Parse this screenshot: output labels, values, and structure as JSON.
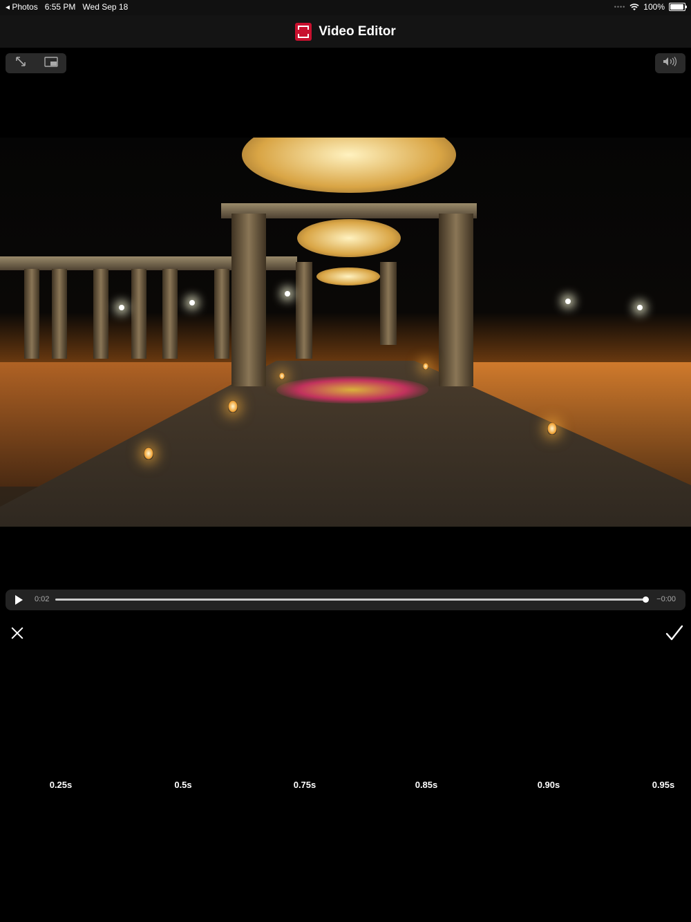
{
  "status_bar": {
    "back_app": "Photos",
    "time": "6:55 PM",
    "date": "Wed Sep 18",
    "battery": "100%",
    "battery_level": 1.0
  },
  "nav": {
    "title": "Video Editor"
  },
  "player": {
    "expand_icon": "expand-icon",
    "pip_icon": "picture-in-picture-icon",
    "volume_icon": "volume-icon",
    "current_time": "0:02",
    "remaining_time": "−0:00",
    "progress": 1.0
  },
  "actions": {
    "cancel_icon": "close-icon",
    "confirm_icon": "checkmark-icon"
  },
  "speed_options": [
    "0.25s",
    "0.5s",
    "0.75s",
    "0.85s",
    "0.90s",
    "0.95s"
  ]
}
